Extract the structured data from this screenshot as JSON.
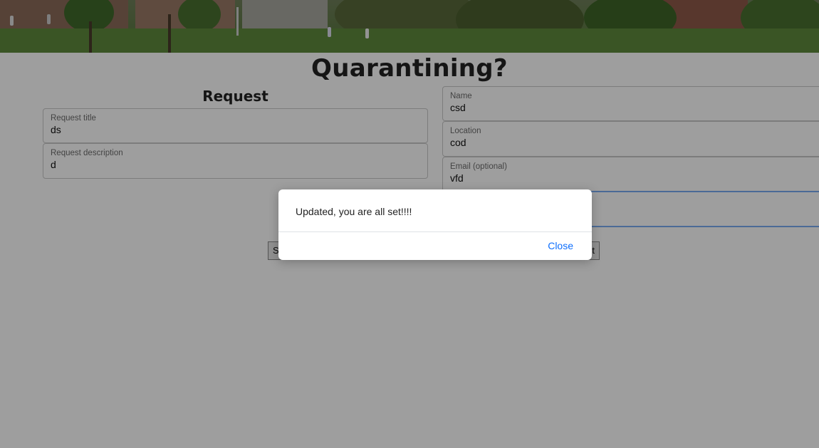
{
  "page": {
    "title": "Quarantining?"
  },
  "request_section": {
    "heading": "Request",
    "title_field": {
      "label": "Request title",
      "value": "ds"
    },
    "description_field": {
      "label": "Request description",
      "value": "d"
    }
  },
  "contact_section": {
    "name_field": {
      "label": "Name",
      "value": "csd"
    },
    "location_field": {
      "label": "Location",
      "value": "cod"
    },
    "email_field": {
      "label": "Email (optional)",
      "value": "vfd"
    },
    "extra_field": {
      "label": "",
      "value": ""
    }
  },
  "actions": {
    "left_button_label": "S",
    "right_button_label": "t"
  },
  "modal": {
    "message": "Updated, you are all set!!!!",
    "close_label": "Close"
  },
  "colors": {
    "link_blue": "#0d6efd",
    "focus_border": "#86b7fe"
  }
}
